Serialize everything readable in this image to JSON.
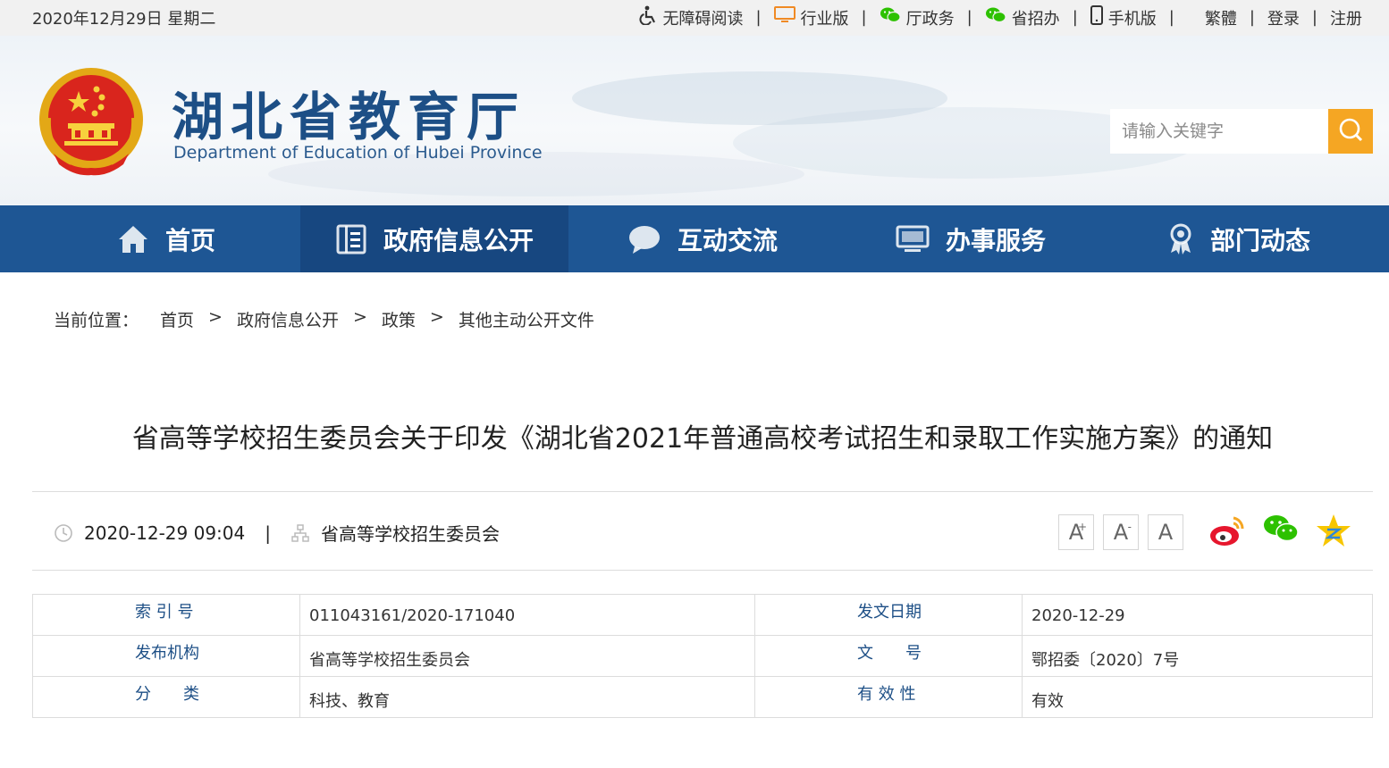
{
  "topbar": {
    "date": "2020年12月29日 星期二",
    "links": [
      {
        "label": "无障碍阅读",
        "icon": "wheelchair-icon"
      },
      {
        "label": "行业版",
        "icon": "monitor-icon"
      },
      {
        "label": "厅政务",
        "icon": "wechat-icon"
      },
      {
        "label": "省招办",
        "icon": "wechat-icon"
      },
      {
        "label": "手机版",
        "icon": "mobile-icon"
      }
    ],
    "extras": [
      "繁體",
      "登录",
      "注册"
    ],
    "separator": "|"
  },
  "header": {
    "title": "湖北省教育厅",
    "subtitle": "Department of Education of Hubei Province",
    "search_placeholder": "请输入关键字"
  },
  "nav": {
    "items": [
      {
        "label": "首页",
        "icon": "home-icon"
      },
      {
        "label": "政府信息公开",
        "icon": "document-icon",
        "active": true
      },
      {
        "label": "互动交流",
        "icon": "chat-bubble-icon"
      },
      {
        "label": "办事服务",
        "icon": "screen-icon"
      },
      {
        "label": "部门动态",
        "icon": "award-person-icon"
      }
    ]
  },
  "breadcrumb": {
    "label": "当前位置：",
    "items": [
      "首页",
      "政府信息公开",
      "政策",
      "其他主动公开文件"
    ],
    "arrow": ">"
  },
  "article": {
    "title": "省高等学校招生委员会关于印发《湖北省2021年普通高校考试招生和录取工作实施方案》的通知",
    "datetime": "2020-12-29 09:04",
    "source": "省高等学校招生委员会",
    "separator": "|",
    "font_buttons": [
      "A",
      "A",
      "A"
    ],
    "font_button_marks": [
      "+",
      "-",
      ""
    ]
  },
  "info_table": {
    "rows": [
      {
        "k1": "索 引 号",
        "v1": "011043161/2020-171040",
        "k2": "发文日期",
        "v2": "2020-12-29"
      },
      {
        "k1": "发布机构",
        "v1": "省高等学校招生委员会",
        "k2": "文　　号",
        "v2": "鄂招委〔2020〕7号"
      },
      {
        "k1": "分　　类",
        "v1": "科技、教育",
        "k2": "有 效 性",
        "v2": "有效"
      }
    ]
  },
  "colors": {
    "nav_bg": "#1e5694",
    "nav_active": "#174780",
    "search_button": "#f5a623",
    "title_blue": "#1d4f86",
    "weibo": "#e6162d",
    "wechat": "#2dc100",
    "qzone": "#f7c600"
  }
}
